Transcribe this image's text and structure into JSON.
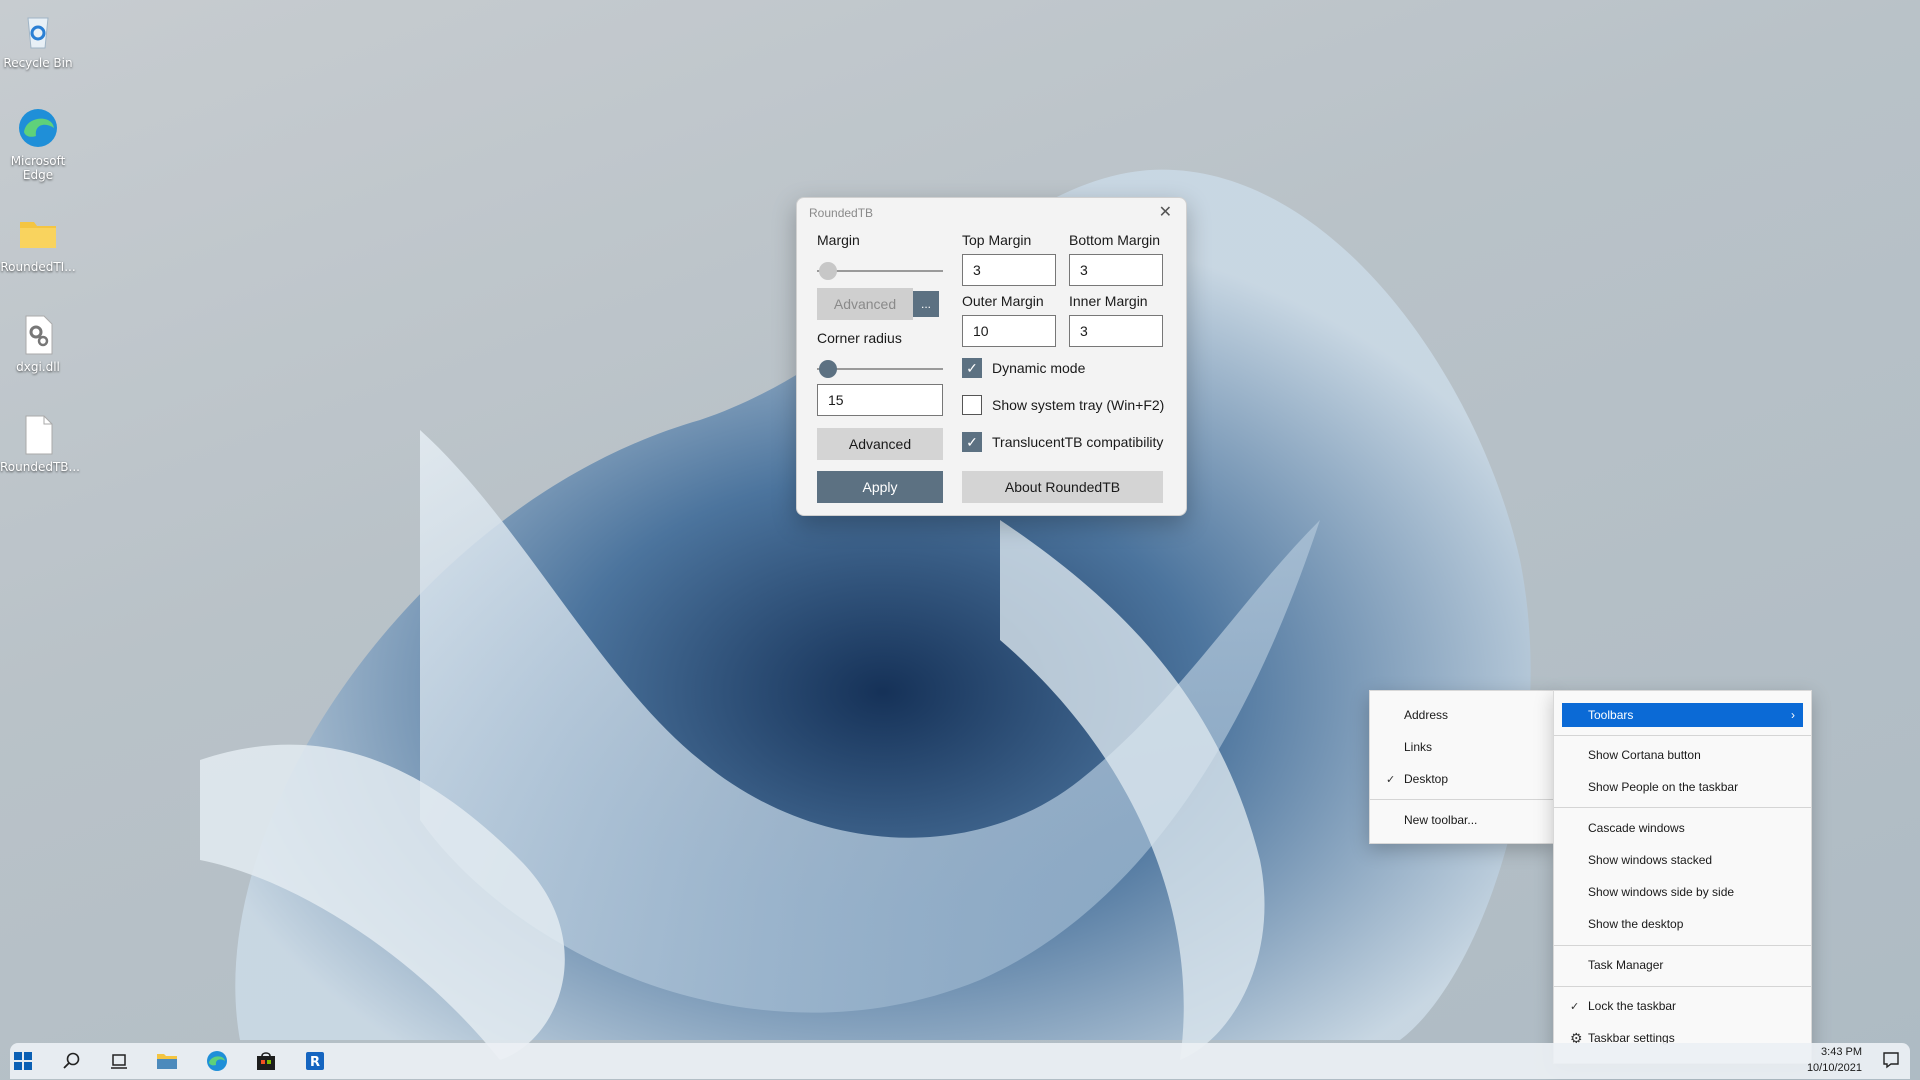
{
  "desktop": {
    "icons": [
      {
        "label": "Recycle Bin",
        "icon": "recycle-bin-icon"
      },
      {
        "label": "Microsoft Edge",
        "icon": "edge-icon"
      },
      {
        "label": "RoundedTI...",
        "icon": "folder-icon"
      },
      {
        "label": "dxgi.dll",
        "icon": "dll-file-icon"
      },
      {
        "label": "RoundedTB...",
        "icon": "file-icon"
      }
    ]
  },
  "roundedtb": {
    "title": "RoundedTB",
    "margin_label": "Margin",
    "margin_slider": 0,
    "advanced_disabled_label": "Advanced",
    "dots_label": "...",
    "corner_radius_label": "Corner radius",
    "corner_radius_slider": 0,
    "corner_radius_value": "15",
    "advanced_label": "Advanced",
    "apply_label": "Apply",
    "top_margin_label": "Top Margin",
    "top_margin_value": "3",
    "bottom_margin_label": "Bottom Margin",
    "bottom_margin_value": "3",
    "outer_margin_label": "Outer Margin",
    "outer_margin_value": "10",
    "inner_margin_label": "Inner Margin",
    "inner_margin_value": "3",
    "dynamic_mode_label": "Dynamic mode",
    "dynamic_mode_checked": true,
    "system_tray_label": "Show system tray (Win+F2)",
    "system_tray_checked": false,
    "translucenttb_label": "TranslucentTB compatibility",
    "translucenttb_checked": true,
    "about_label": "About RoundedTB"
  },
  "toolbars_submenu": {
    "items": [
      {
        "label": "Address",
        "checked": false
      },
      {
        "label": "Links",
        "checked": false
      },
      {
        "label": "Desktop",
        "checked": true
      },
      {
        "label": "New toolbar...",
        "checked": false
      }
    ]
  },
  "taskbar_menu": {
    "toolbars": "Toolbars",
    "show_cortana": "Show Cortana button",
    "show_people": "Show People on the taskbar",
    "cascade": "Cascade windows",
    "stacked": "Show windows stacked",
    "side_by_side": "Show windows side by side",
    "show_desktop": "Show the desktop",
    "task_manager": "Task Manager",
    "lock_taskbar": "Lock the taskbar",
    "lock_checked": true,
    "taskbar_settings": "Taskbar settings"
  },
  "taskbar": {
    "time": "3:43 PM",
    "date": "10/10/2021",
    "icons": [
      "start-icon",
      "search-icon",
      "task-view-icon",
      "file-explorer-icon",
      "edge-icon",
      "store-icon",
      "roundedtb-icon"
    ]
  },
  "colors": {
    "accent": "#0b6ad6",
    "app_accent": "#5c7182"
  }
}
